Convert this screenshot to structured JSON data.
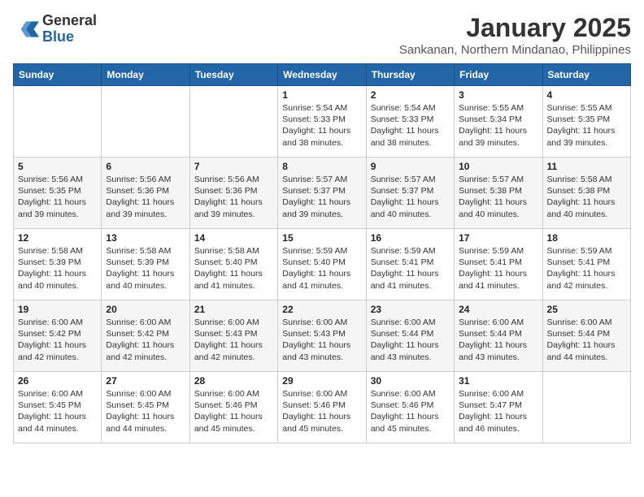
{
  "header": {
    "logo_general": "General",
    "logo_blue": "Blue",
    "month_title": "January 2025",
    "subtitle": "Sankanan, Northern Mindanao, Philippines"
  },
  "days_of_week": [
    "Sunday",
    "Monday",
    "Tuesday",
    "Wednesday",
    "Thursday",
    "Friday",
    "Saturday"
  ],
  "weeks": [
    [
      {
        "day": "",
        "info": ""
      },
      {
        "day": "",
        "info": ""
      },
      {
        "day": "",
        "info": ""
      },
      {
        "day": "1",
        "info": "Sunrise: 5:54 AM\nSunset: 5:33 PM\nDaylight: 11 hours\nand 38 minutes."
      },
      {
        "day": "2",
        "info": "Sunrise: 5:54 AM\nSunset: 5:33 PM\nDaylight: 11 hours\nand 38 minutes."
      },
      {
        "day": "3",
        "info": "Sunrise: 5:55 AM\nSunset: 5:34 PM\nDaylight: 11 hours\nand 39 minutes."
      },
      {
        "day": "4",
        "info": "Sunrise: 5:55 AM\nSunset: 5:35 PM\nDaylight: 11 hours\nand 39 minutes."
      }
    ],
    [
      {
        "day": "5",
        "info": "Sunrise: 5:56 AM\nSunset: 5:35 PM\nDaylight: 11 hours\nand 39 minutes."
      },
      {
        "day": "6",
        "info": "Sunrise: 5:56 AM\nSunset: 5:36 PM\nDaylight: 11 hours\nand 39 minutes."
      },
      {
        "day": "7",
        "info": "Sunrise: 5:56 AM\nSunset: 5:36 PM\nDaylight: 11 hours\nand 39 minutes."
      },
      {
        "day": "8",
        "info": "Sunrise: 5:57 AM\nSunset: 5:37 PM\nDaylight: 11 hours\nand 39 minutes."
      },
      {
        "day": "9",
        "info": "Sunrise: 5:57 AM\nSunset: 5:37 PM\nDaylight: 11 hours\nand 40 minutes."
      },
      {
        "day": "10",
        "info": "Sunrise: 5:57 AM\nSunset: 5:38 PM\nDaylight: 11 hours\nand 40 minutes."
      },
      {
        "day": "11",
        "info": "Sunrise: 5:58 AM\nSunset: 5:38 PM\nDaylight: 11 hours\nand 40 minutes."
      }
    ],
    [
      {
        "day": "12",
        "info": "Sunrise: 5:58 AM\nSunset: 5:39 PM\nDaylight: 11 hours\nand 40 minutes."
      },
      {
        "day": "13",
        "info": "Sunrise: 5:58 AM\nSunset: 5:39 PM\nDaylight: 11 hours\nand 40 minutes."
      },
      {
        "day": "14",
        "info": "Sunrise: 5:58 AM\nSunset: 5:40 PM\nDaylight: 11 hours\nand 41 minutes."
      },
      {
        "day": "15",
        "info": "Sunrise: 5:59 AM\nSunset: 5:40 PM\nDaylight: 11 hours\nand 41 minutes."
      },
      {
        "day": "16",
        "info": "Sunrise: 5:59 AM\nSunset: 5:41 PM\nDaylight: 11 hours\nand 41 minutes."
      },
      {
        "day": "17",
        "info": "Sunrise: 5:59 AM\nSunset: 5:41 PM\nDaylight: 11 hours\nand 41 minutes."
      },
      {
        "day": "18",
        "info": "Sunrise: 5:59 AM\nSunset: 5:41 PM\nDaylight: 11 hours\nand 42 minutes."
      }
    ],
    [
      {
        "day": "19",
        "info": "Sunrise: 6:00 AM\nSunset: 5:42 PM\nDaylight: 11 hours\nand 42 minutes."
      },
      {
        "day": "20",
        "info": "Sunrise: 6:00 AM\nSunset: 5:42 PM\nDaylight: 11 hours\nand 42 minutes."
      },
      {
        "day": "21",
        "info": "Sunrise: 6:00 AM\nSunset: 5:43 PM\nDaylight: 11 hours\nand 42 minutes."
      },
      {
        "day": "22",
        "info": "Sunrise: 6:00 AM\nSunset: 5:43 PM\nDaylight: 11 hours\nand 43 minutes."
      },
      {
        "day": "23",
        "info": "Sunrise: 6:00 AM\nSunset: 5:44 PM\nDaylight: 11 hours\nand 43 minutes."
      },
      {
        "day": "24",
        "info": "Sunrise: 6:00 AM\nSunset: 5:44 PM\nDaylight: 11 hours\nand 43 minutes."
      },
      {
        "day": "25",
        "info": "Sunrise: 6:00 AM\nSunset: 5:44 PM\nDaylight: 11 hours\nand 44 minutes."
      }
    ],
    [
      {
        "day": "26",
        "info": "Sunrise: 6:00 AM\nSunset: 5:45 PM\nDaylight: 11 hours\nand 44 minutes."
      },
      {
        "day": "27",
        "info": "Sunrise: 6:00 AM\nSunset: 5:45 PM\nDaylight: 11 hours\nand 44 minutes."
      },
      {
        "day": "28",
        "info": "Sunrise: 6:00 AM\nSunset: 5:46 PM\nDaylight: 11 hours\nand 45 minutes."
      },
      {
        "day": "29",
        "info": "Sunrise: 6:00 AM\nSunset: 5:46 PM\nDaylight: 11 hours\nand 45 minutes."
      },
      {
        "day": "30",
        "info": "Sunrise: 6:00 AM\nSunset: 5:46 PM\nDaylight: 11 hours\nand 45 minutes."
      },
      {
        "day": "31",
        "info": "Sunrise: 6:00 AM\nSunset: 5:47 PM\nDaylight: 11 hours\nand 46 minutes."
      },
      {
        "day": "",
        "info": ""
      }
    ]
  ]
}
